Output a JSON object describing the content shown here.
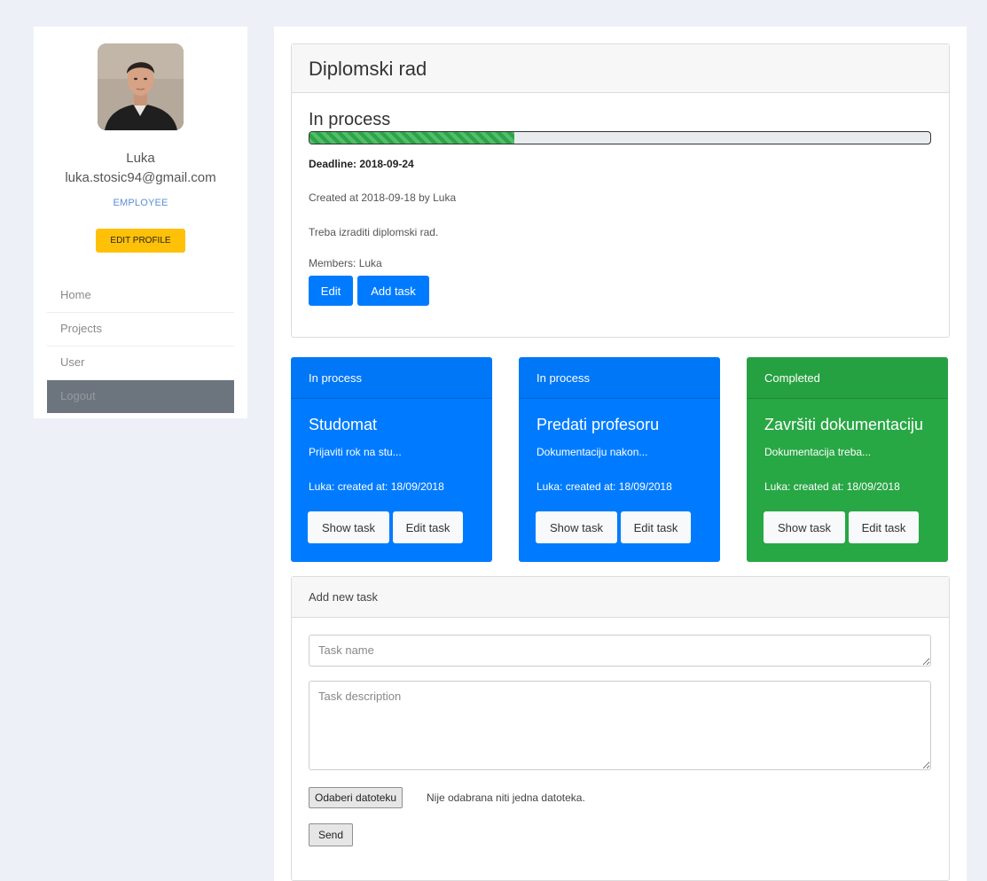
{
  "profile": {
    "name": "Luka",
    "email": "luka.stosic94@gmail.com",
    "role": "EMPLOYEE",
    "edit_label": "EDIT PROFILE"
  },
  "nav": {
    "items": [
      {
        "label": "Home"
      },
      {
        "label": "Projects"
      },
      {
        "label": "User"
      },
      {
        "label": "Logout"
      }
    ]
  },
  "project": {
    "title": "Diplomski rad",
    "status": "In process",
    "progress_percent": 33,
    "deadline": "Deadline: 2018-09-24",
    "created": "Created at 2018-09-18 by Luka",
    "description": "Treba izraditi diplomski rad.",
    "members_label": "Members:",
    "members": "Luka",
    "edit_label": "Edit",
    "add_task_label": "Add task"
  },
  "tasks": [
    {
      "status": "In process",
      "title": "Studomat",
      "description": "Prijaviti rok na stu...",
      "meta": "Luka: created at: 18/09/2018",
      "show_label": "Show task",
      "edit_label": "Edit task",
      "color": "#007bff"
    },
    {
      "status": "In process",
      "title": "Predati profesoru",
      "description": "Dokumentaciju nakon...",
      "meta": "Luka: created at: 18/09/2018",
      "show_label": "Show task",
      "edit_label": "Edit task",
      "color": "#007bff"
    },
    {
      "status": "Completed",
      "title": "Završiti dokumentaciju",
      "description": "Dokumentacija treba...",
      "meta": "Luka: created at: 18/09/2018",
      "show_label": "Show task",
      "edit_label": "Edit task",
      "color": "#28a745"
    }
  ],
  "form": {
    "header": "Add new task",
    "name_placeholder": "Task name",
    "description_placeholder": "Task description",
    "file_button_label": "Odaberi datoteku",
    "file_status": "Nije odabrana niti jedna datoteka.",
    "send_label": "Send"
  },
  "colors": {
    "primary": "#007bff",
    "success": "#28a745",
    "warning": "#ffc107",
    "page_background": "#edf1f7"
  }
}
